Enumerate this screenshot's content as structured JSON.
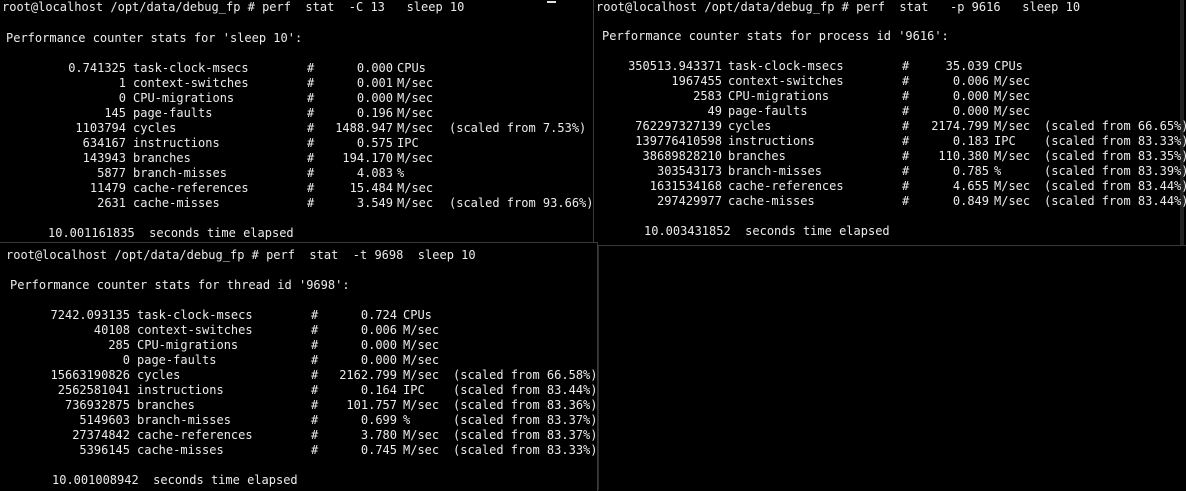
{
  "colors": {
    "background": "#000000",
    "text": "#ececec",
    "divider": "#3a3a3a"
  },
  "terminals": [
    {
      "prompt": "root@localhost /opt/data/debug_fp # perf  stat  -C 13   sleep 10",
      "header": "Performance counter stats for 'sleep 10':",
      "rows": [
        {
          "value": "0.741325",
          "event": "task-clock-msecs",
          "hash": "#",
          "metric": "0.000",
          "unit": "CPUs",
          "scaled": ""
        },
        {
          "value": "1",
          "event": "context-switches",
          "hash": "#",
          "metric": "0.001",
          "unit": "M/sec",
          "scaled": ""
        },
        {
          "value": "0",
          "event": "CPU-migrations",
          "hash": "#",
          "metric": "0.000",
          "unit": "M/sec",
          "scaled": ""
        },
        {
          "value": "145",
          "event": "page-faults",
          "hash": "#",
          "metric": "0.196",
          "unit": "M/sec",
          "scaled": ""
        },
        {
          "value": "1103794",
          "event": "cycles",
          "hash": "#",
          "metric": "1488.947",
          "unit": "M/sec",
          "scaled": "(scaled from 7.53%)"
        },
        {
          "value": "634167",
          "event": "instructions",
          "hash": "#",
          "metric": "0.575",
          "unit": "IPC",
          "scaled": ""
        },
        {
          "value": "143943",
          "event": "branches",
          "hash": "#",
          "metric": "194.170",
          "unit": "M/sec",
          "scaled": ""
        },
        {
          "value": "5877",
          "event": "branch-misses",
          "hash": "#",
          "metric": "4.083",
          "unit": "%",
          "scaled": ""
        },
        {
          "value": "11479",
          "event": "cache-references",
          "hash": "#",
          "metric": "15.484",
          "unit": "M/sec",
          "scaled": ""
        },
        {
          "value": "2631",
          "event": "cache-misses",
          "hash": "#",
          "metric": "3.549",
          "unit": "M/sec",
          "scaled": "(scaled from 93.66%)"
        }
      ],
      "elapsed": "10.001161835  seconds time elapsed"
    },
    {
      "prompt": "root@localhost /opt/data/debug_fp # perf  stat   -p 9616   sleep 10",
      "header": "Performance counter stats for process id '9616':",
      "rows": [
        {
          "value": "350513.943371",
          "event": "task-clock-msecs",
          "hash": "#",
          "metric": "35.039",
          "unit": "CPUs",
          "scaled": ""
        },
        {
          "value": "1967455",
          "event": "context-switches",
          "hash": "#",
          "metric": "0.006",
          "unit": "M/sec",
          "scaled": ""
        },
        {
          "value": "2583",
          "event": "CPU-migrations",
          "hash": "#",
          "metric": "0.000",
          "unit": "M/sec",
          "scaled": ""
        },
        {
          "value": "49",
          "event": "page-faults",
          "hash": "#",
          "metric": "0.000",
          "unit": "M/sec",
          "scaled": ""
        },
        {
          "value": "762297327139",
          "event": "cycles",
          "hash": "#",
          "metric": "2174.799",
          "unit": "M/sec",
          "scaled": "(scaled from 66.65%)"
        },
        {
          "value": "139776410598",
          "event": "instructions",
          "hash": "#",
          "metric": "0.183",
          "unit": "IPC",
          "scaled": "(scaled from 83.33%)"
        },
        {
          "value": "38689828210",
          "event": "branches",
          "hash": "#",
          "metric": "110.380",
          "unit": "M/sec",
          "scaled": "(scaled from 83.35%)"
        },
        {
          "value": "303543173",
          "event": "branch-misses",
          "hash": "#",
          "metric": "0.785",
          "unit": "%",
          "scaled": "(scaled from 83.39%)"
        },
        {
          "value": "1631534168",
          "event": "cache-references",
          "hash": "#",
          "metric": "4.655",
          "unit": "M/sec",
          "scaled": "(scaled from 83.44%)"
        },
        {
          "value": "297429977",
          "event": "cache-misses",
          "hash": "#",
          "metric": "0.849",
          "unit": "M/sec",
          "scaled": "(scaled from 83.44%)"
        }
      ],
      "elapsed": "10.003431852  seconds time elapsed"
    },
    {
      "prompt": "root@localhost /opt/data/debug_fp # perf  stat  -t 9698  sleep 10",
      "header": "Performance counter stats for thread id '9698':",
      "rows": [
        {
          "value": "7242.093135",
          "event": "task-clock-msecs",
          "hash": "#",
          "metric": "0.724",
          "unit": "CPUs",
          "scaled": ""
        },
        {
          "value": "40108",
          "event": "context-switches",
          "hash": "#",
          "metric": "0.006",
          "unit": "M/sec",
          "scaled": ""
        },
        {
          "value": "285",
          "event": "CPU-migrations",
          "hash": "#",
          "metric": "0.000",
          "unit": "M/sec",
          "scaled": ""
        },
        {
          "value": "0",
          "event": "page-faults",
          "hash": "#",
          "metric": "0.000",
          "unit": "M/sec",
          "scaled": ""
        },
        {
          "value": "15663190826",
          "event": "cycles",
          "hash": "#",
          "metric": "2162.799",
          "unit": "M/sec",
          "scaled": "(scaled from 66.58%)"
        },
        {
          "value": "2562581041",
          "event": "instructions",
          "hash": "#",
          "metric": "0.164",
          "unit": "IPC",
          "scaled": "(scaled from 83.44%)"
        },
        {
          "value": "736932875",
          "event": "branches",
          "hash": "#",
          "metric": "101.757",
          "unit": "M/sec",
          "scaled": "(scaled from 83.36%)"
        },
        {
          "value": "5149603",
          "event": "branch-misses",
          "hash": "#",
          "metric": "0.699",
          "unit": "%",
          "scaled": "(scaled from 83.37%)"
        },
        {
          "value": "27374842",
          "event": "cache-references",
          "hash": "#",
          "metric": "3.780",
          "unit": "M/sec",
          "scaled": "(scaled from 83.37%)"
        },
        {
          "value": "5396145",
          "event": "cache-misses",
          "hash": "#",
          "metric": "0.745",
          "unit": "M/sec",
          "scaled": "(scaled from 83.33%)"
        }
      ],
      "elapsed": "10.001008942  seconds time elapsed"
    }
  ]
}
